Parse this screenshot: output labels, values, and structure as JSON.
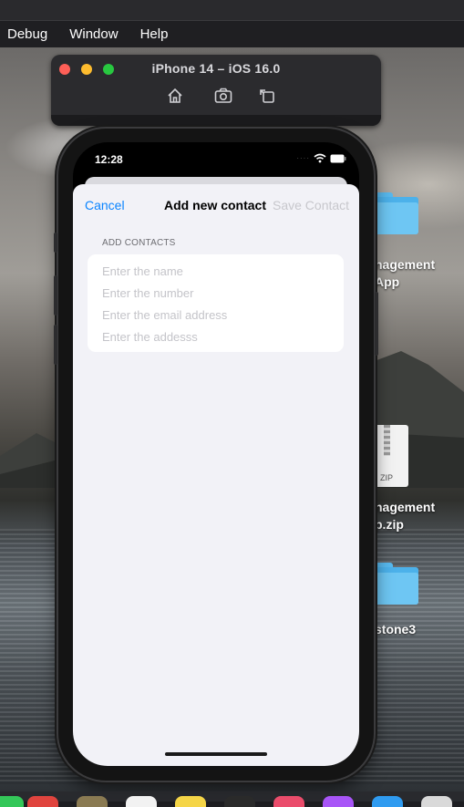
{
  "menubar": {
    "items": [
      "Debug",
      "Window",
      "Help"
    ]
  },
  "simulator": {
    "title": "iPhone 14 – iOS 16.0",
    "icons": [
      "home-icon",
      "screenshot-icon",
      "rotate-icon"
    ]
  },
  "desktop": {
    "items": [
      {
        "label_line1": "nagement",
        "label_line2": "App",
        "icon": "folder-icon"
      },
      {
        "label_line1": "nagement",
        "label_line2": "p.zip",
        "icon": "zip-icon",
        "badge": "ZIP"
      },
      {
        "label_line1": "stone3",
        "icon": "folder-icon"
      }
    ]
  },
  "phone": {
    "status": {
      "time": "12:28"
    },
    "nav": {
      "cancel": "Cancel",
      "title": "Add new contact",
      "save": "Save Contact"
    },
    "section_header": "ADD CONTACTS",
    "fields": [
      {
        "placeholder": "Enter the name",
        "value": ""
      },
      {
        "placeholder": "Enter the number",
        "value": ""
      },
      {
        "placeholder": "Enter the email address",
        "value": ""
      },
      {
        "placeholder": "Enter the addesss",
        "value": ""
      }
    ]
  },
  "colors": {
    "ios_blue": "#0a84ff",
    "disabled_gray": "#c7c7cc",
    "grouped_background": "#f2f2f7"
  }
}
